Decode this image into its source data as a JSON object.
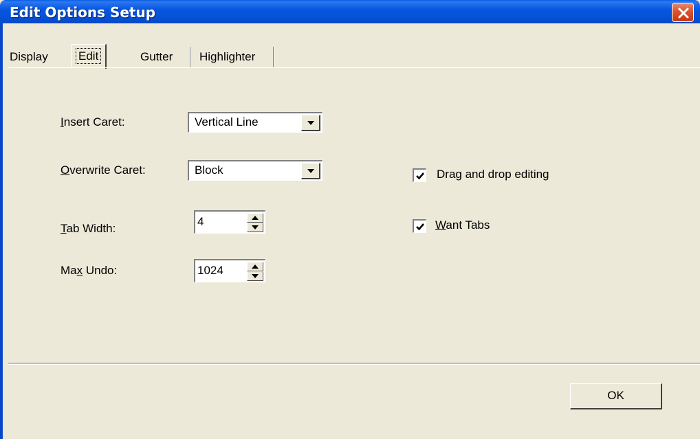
{
  "window": {
    "title": "Edit Options Setup"
  },
  "tabs": [
    {
      "label": "Display"
    },
    {
      "label": "Edit"
    },
    {
      "label": "Gutter"
    },
    {
      "label": "Highlighter"
    }
  ],
  "edit": {
    "insert_caret": {
      "label_key": "I",
      "label_rest": "nsert Caret:",
      "value": "Vertical Line"
    },
    "overwrite_caret": {
      "label_key": "O",
      "label_rest": "verwrite Caret:",
      "value": "Block"
    },
    "tab_width": {
      "label_key": "T",
      "label_rest": "ab Width:",
      "value": "4"
    },
    "max_undo": {
      "label_pre": "Ma",
      "label_key": "x",
      "label_rest": " Undo:",
      "value": "1024"
    },
    "drag_drop": {
      "label": "Drag and drop editing",
      "checked": true
    },
    "want_tabs": {
      "label_key": "W",
      "label_rest": "ant Tabs",
      "checked": true
    }
  },
  "footer": {
    "ok_label": "OK"
  },
  "icons": {
    "close": "close-icon",
    "dropdown": "chevron-down-icon",
    "spin_up": "spin-up-icon",
    "spin_down": "spin-down-icon",
    "check": "checkmark-icon"
  }
}
